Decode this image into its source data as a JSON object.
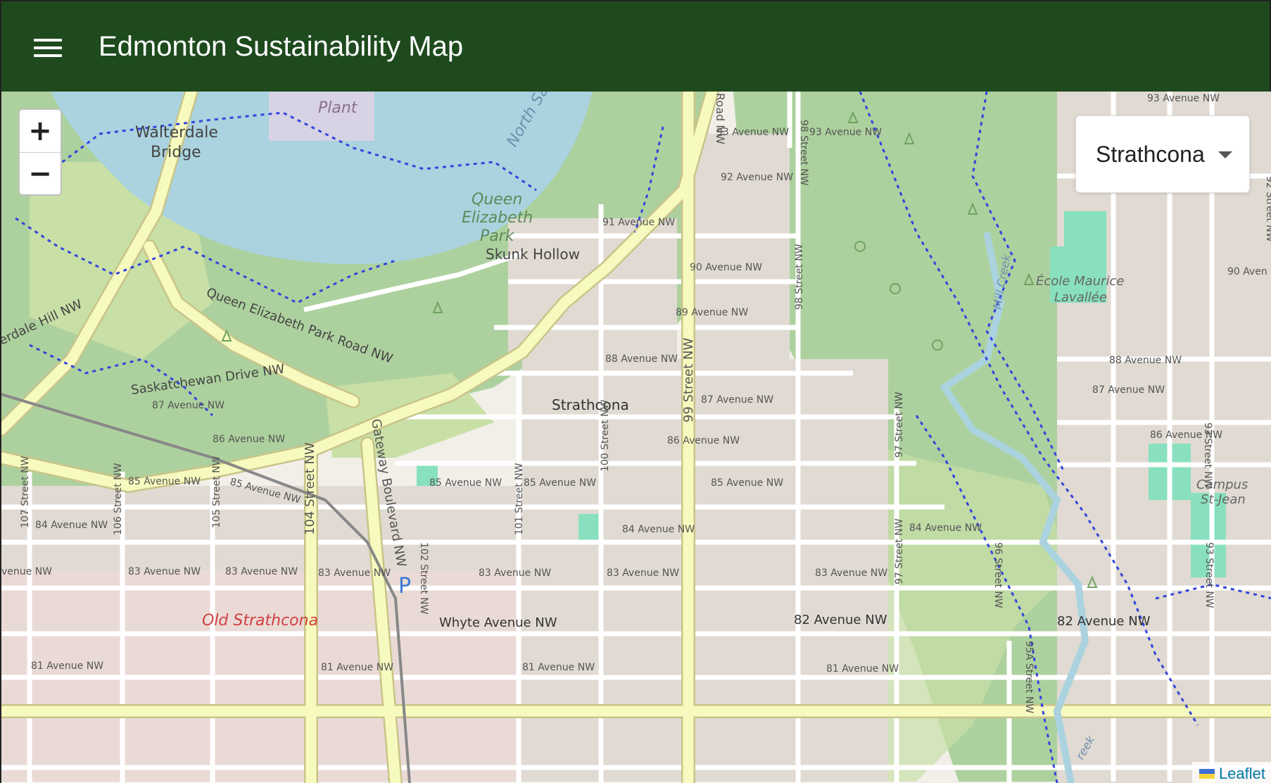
{
  "header": {
    "title": "Edmonton Sustainability Map",
    "menu_icon": "hamburger-menu-icon"
  },
  "zoom": {
    "in_label": "+",
    "out_label": "−"
  },
  "neighbourhood_select": {
    "selected": "Strathcona"
  },
  "attribution": {
    "label": "Leaflet"
  },
  "colors": {
    "header_bg": "#1e4a1e",
    "park": "#c8dfa6",
    "forest": "#add19e",
    "river": "#aad3df",
    "major_road": "#f7fabf",
    "path": "#3344dd"
  },
  "map_labels": {
    "plant": "Plant",
    "walterdale_1": "Walterdale",
    "walterdale_2": "Bridge",
    "north_sask": "North Sask",
    "qe_park_1": "Queen",
    "qe_park_2": "Elizabeth",
    "qe_park_3": "Park",
    "skunk_hollow": "Skunk Hollow",
    "qe_park_road": "Queen Elizabeth Park Road NW",
    "erdale_hill": "erdale Hill NW",
    "sask_drive": "Saskatchewan Drive NW",
    "strathcona": "Strathcona",
    "old_strathcona": "Old Strathcona",
    "whyte_ave": "Whyte Avenue NW",
    "ave82_a": "82 Avenue NW",
    "ave82_b": "82 Avenue NW",
    "ecole_1": "École Maurice",
    "ecole_2": "Lavallée",
    "campus_1": "Campus",
    "campus_2": "St-Jean",
    "mill_creek": "Mill Creek",
    "creek": "reek",
    "ave93_a": "93 Avenue NW",
    "ave93_b": "93 Avenue NW",
    "ave93_c": "93 Avenue NW",
    "ave92": "92 Avenue NW",
    "ave91": "91 Avenue NW",
    "ave90_a": "90 Avenue NW",
    "ave90_b": "90 Aven",
    "ave89": "89 Avenue NW",
    "ave88_a": "88 Avenue NW",
    "ave88_b": "88 Avenue NW",
    "ave87_a": "87 Avenue NW",
    "ave87_b": "87 Avenue NW",
    "ave87_c": "87 Avenue NW",
    "ave86_a": "86 Avenue NW",
    "ave86_b": "86 Avenue NW",
    "ave86_c": "86 Avenue NW",
    "ave85_a": "85 Avenue NW",
    "ave85_b": "85 Avenue NW",
    "ave85_c": "85 Avenue NW",
    "ave85_d": "85 Avenue NW",
    "ave85_e": "85 Avenue NW",
    "ave84_a": "84 Avenue NW",
    "ave84_b": "84 Avenue NW",
    "ave84_c": "84 Avenue NW",
    "ave83_a": "venue NW",
    "ave83_b": "83 Avenue NW",
    "ave83_c": "83 Avenue NW",
    "ave83_d": "83 Avenue NW",
    "ave83_e": "83 Avenue NW",
    "ave83_f": "83 Avenue NW",
    "ave83_g": "83 Avenue NW",
    "ave81_a": "81 Avenue NW",
    "ave81_b": "81 Avenue NW",
    "ave81_c": "81 Avenue NW",
    "ave81_d": "81 Avenue NW",
    "st107": "107 Street NW",
    "st106": "106 Street NW",
    "st105": "105 Street NW",
    "st104": "104 Street NW",
    "gateway": "Gateway Boulevard NW",
    "st102": "102 Street NW",
    "st101": "101 Street NW",
    "st100": "100 Street NW",
    "st99": "99 Street NW",
    "st98_a": "98 Street NW",
    "st98_b": "98 Street NW",
    "st97_a": "97 Street NW",
    "st97_b": "97 Street NW",
    "st96": "96 Street NW",
    "st95a": "95A Street NW",
    "st93_a": "93 Street NW",
    "st93_b": "93 Street NW",
    "st92": "92 Street NW",
    "road_nw": "Road NW",
    "parking": "P"
  }
}
